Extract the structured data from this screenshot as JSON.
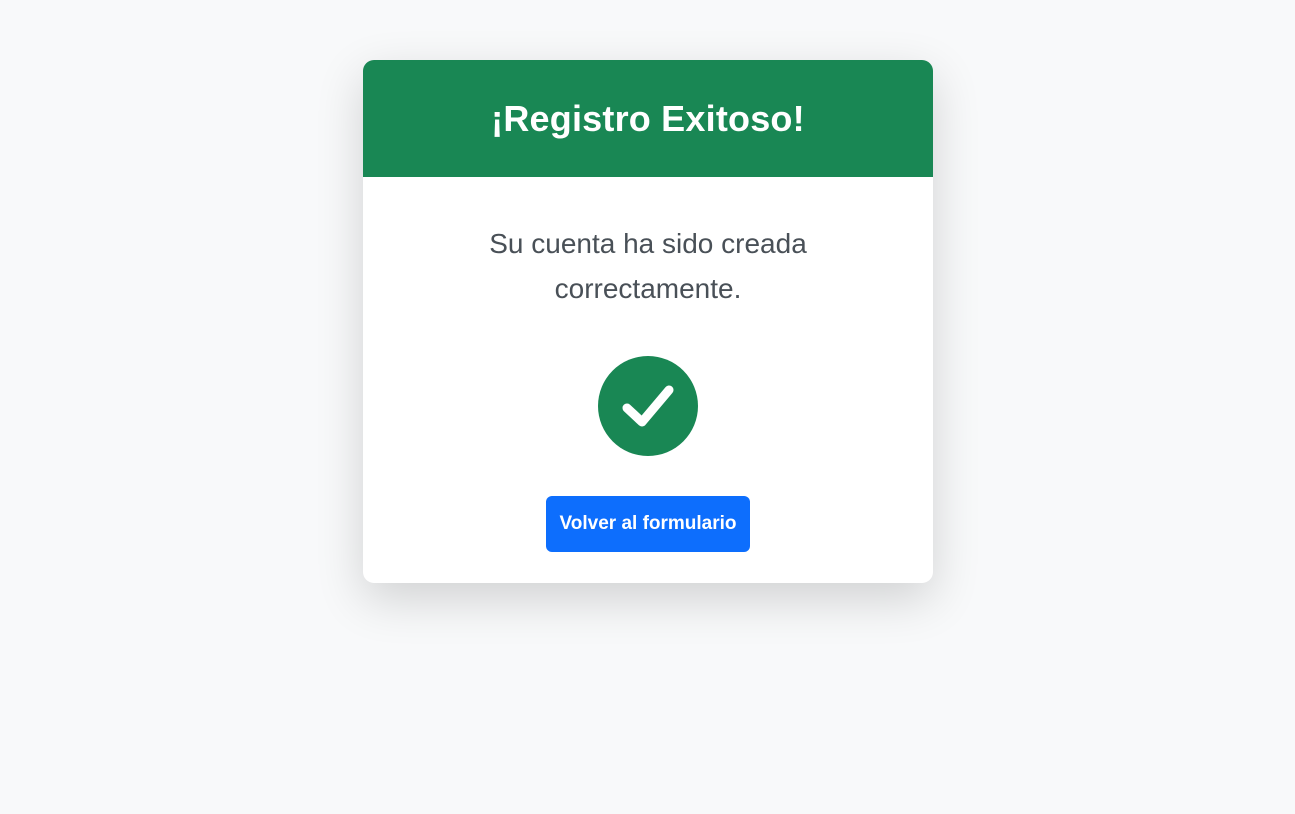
{
  "card": {
    "title": "¡Registro Exitoso!",
    "message": "Su cuenta ha sido creada correctamente.",
    "icon": "check-circle-icon",
    "button_label": "Volver al formulario"
  },
  "colors": {
    "success": "#198754",
    "primary": "#0d6efd",
    "background": "#f8f9fa"
  }
}
